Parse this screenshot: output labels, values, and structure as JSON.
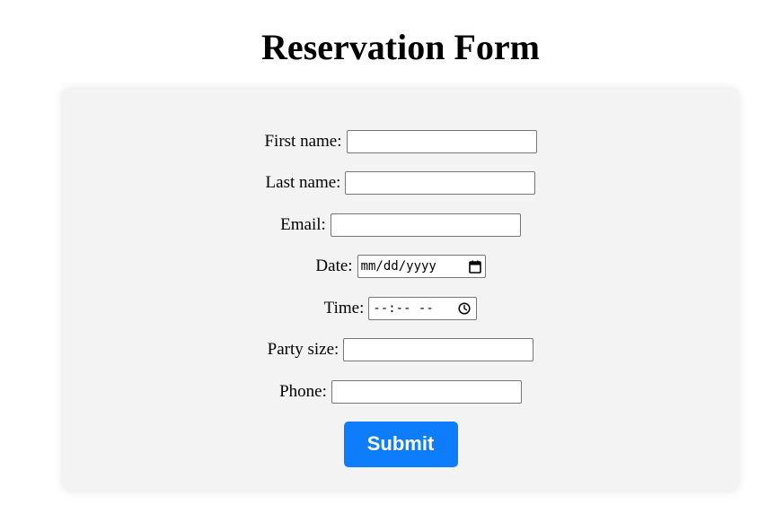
{
  "page": {
    "title": "Reservation Form"
  },
  "form": {
    "fields": [
      {
        "label": "First name:",
        "type": "text",
        "value": ""
      },
      {
        "label": "Last name:",
        "type": "text",
        "value": ""
      },
      {
        "label": "Email:",
        "type": "text",
        "value": ""
      },
      {
        "label": "Date:",
        "type": "date",
        "placeholder": "mm/dd/yyyy",
        "icon": "calendar-icon"
      },
      {
        "label": "Time:",
        "type": "time",
        "placeholder": "--:-- --",
        "icon": "clock-icon"
      },
      {
        "label": "Party size:",
        "type": "text",
        "value": ""
      },
      {
        "label": "Phone:",
        "type": "text",
        "value": ""
      }
    ],
    "submit_label": "Submit"
  },
  "colors": {
    "card_background": "#f3f3f3",
    "submit_background": "#0d7dfc",
    "submit_text": "#ffffff"
  }
}
